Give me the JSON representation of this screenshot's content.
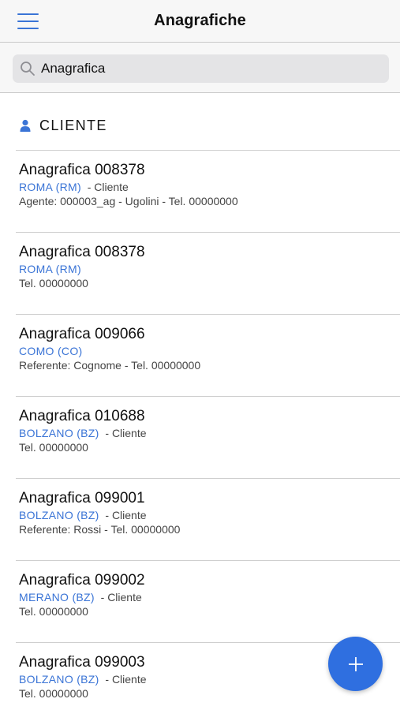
{
  "header": {
    "title": "Anagrafiche",
    "menu_icon": "hamburger-menu-icon"
  },
  "search": {
    "value": "Anagrafica",
    "icon": "search-icon"
  },
  "section": {
    "title": "CLIENTE",
    "icon": "person-icon"
  },
  "items": [
    {
      "name": "Anagrafica 008378",
      "city": "ROMA (RM)",
      "type": "- Cliente",
      "detail": "Agente: 000003_ag - Ugolini - Tel. 00000000"
    },
    {
      "name": "Anagrafica 008378",
      "city": "ROMA (RM)",
      "type": "",
      "detail": "Tel. 00000000"
    },
    {
      "name": "Anagrafica 009066",
      "city": "COMO (CO)",
      "type": "",
      "detail": "Referente: Cognome - Tel. 00000000"
    },
    {
      "name": "Anagrafica 010688",
      "city": "BOLZANO (BZ)",
      "type": "- Cliente",
      "detail": "Tel. 00000000"
    },
    {
      "name": "Anagrafica 099001",
      "city": "BOLZANO (BZ)",
      "type": "- Cliente",
      "detail": "Referente: Rossi - Tel. 00000000"
    },
    {
      "name": "Anagrafica 099002",
      "city": "MERANO (BZ)",
      "type": "- Cliente",
      "detail": "Tel. 00000000"
    },
    {
      "name": "Anagrafica 099003",
      "city": "BOLZANO (BZ)",
      "type": "- Cliente",
      "detail": "Tel. 00000000"
    }
  ],
  "fab": {
    "icon": "plus-icon"
  },
  "colors": {
    "accent": "#3a74d6",
    "fab": "#2f6fe0",
    "bar": "#f7f7f7"
  }
}
